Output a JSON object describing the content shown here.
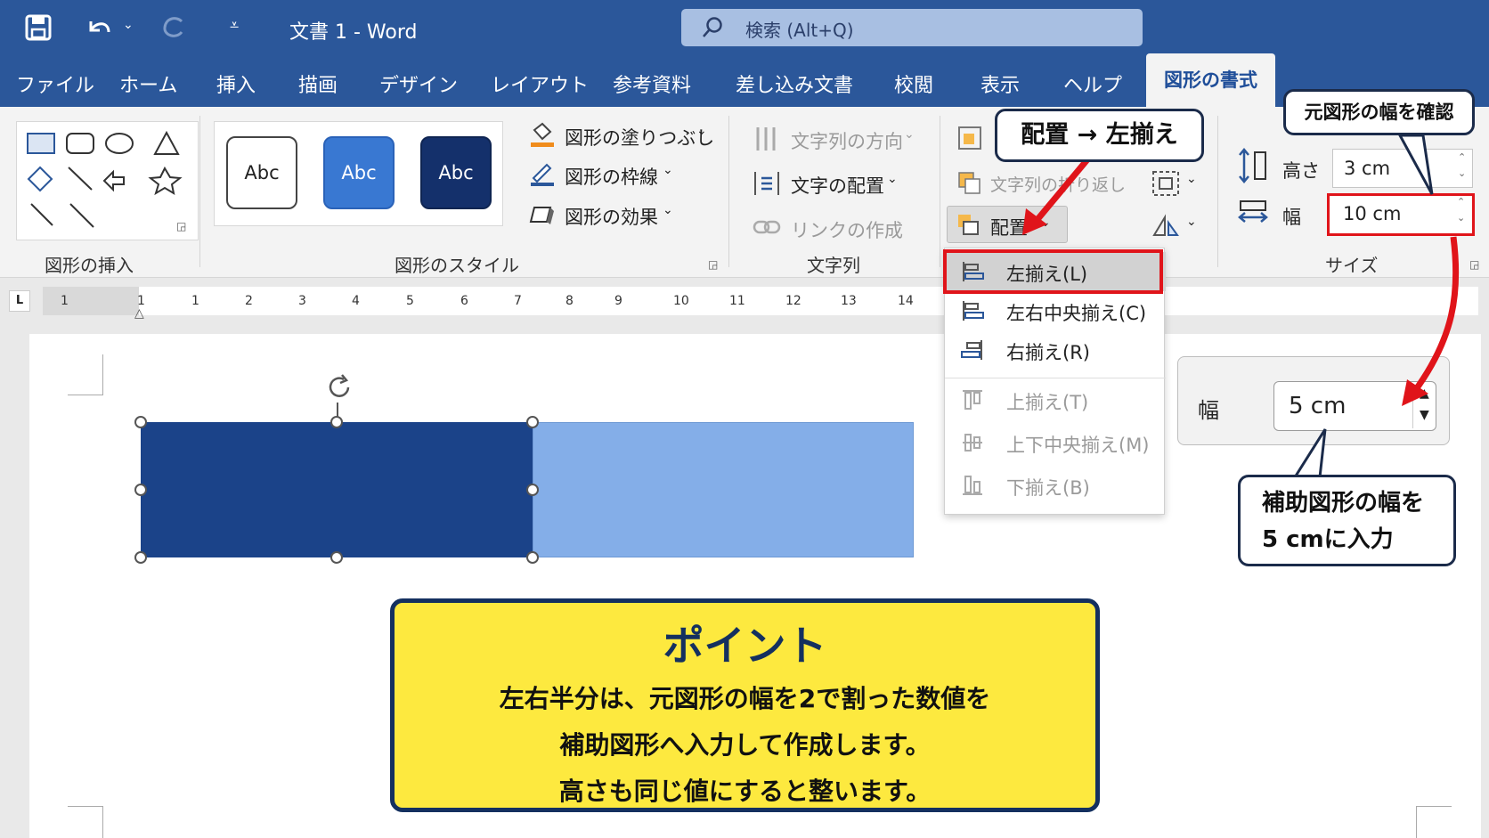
{
  "titlebar": {
    "doc_title": "文書 1 - Word",
    "search_placeholder": "検索 (Alt+Q)"
  },
  "tabs": [
    "ファイル",
    "ホーム",
    "挿入",
    "描画",
    "デザイン",
    "レイアウト",
    "参考資料",
    "差し込み文書",
    "校閲",
    "表示",
    "ヘルプ"
  ],
  "active_tab": "図形の書式",
  "ribbon": {
    "insert_group": "図形の挿入",
    "style_group": "図形のスタイル",
    "style_buttons": [
      "Abc",
      "Abc",
      "Abc"
    ],
    "fill": "図形の塗りつぶし",
    "outline": "図形の枠線",
    "effect": "図形の効果",
    "text_direction": "文字列の方向",
    "text_align": "文字の配置",
    "create_link": "リンクの作成",
    "text_group": "文字列",
    "wrap_text": "文字列の折り返し",
    "arrange": "配置",
    "height_label": "高さ",
    "height_value": "3 cm",
    "width_label": "幅",
    "width_value": "10 cm",
    "size_group": "サイズ"
  },
  "dropdown": {
    "items": [
      "左揃え(L)",
      "左右中央揃え(C)",
      "右揃え(R)",
      "上揃え(T)",
      "上下中央揃え(M)",
      "下揃え(B)"
    ]
  },
  "ruler": {
    "labels": [
      "1",
      "1",
      "1",
      "2",
      "3",
      "4",
      "5",
      "6",
      "7",
      "8",
      "9",
      "10",
      "11",
      "12",
      "13",
      "14"
    ]
  },
  "callouts": {
    "arrange_left": "配置 → 左揃え",
    "check_width": "元図形の幅を確認",
    "enter_width_1": "補助図形の幅を",
    "enter_width_2": "5 cmに入力"
  },
  "popup": {
    "label": "幅",
    "value": "5 cm"
  },
  "point": {
    "title": "ポイント",
    "line1": "左右半分は、元図形の幅を2で割った数値を",
    "line2": "補助図形へ入力して作成します。",
    "line3": "高さも同じ値にすると整います。"
  },
  "colors": {
    "ribbon_blue": "#2b579a",
    "shape_dark": "#1b4389",
    "shape_light": "#84aee8",
    "highlight_red": "#e0141a",
    "point_yellow": "#fde93f"
  }
}
